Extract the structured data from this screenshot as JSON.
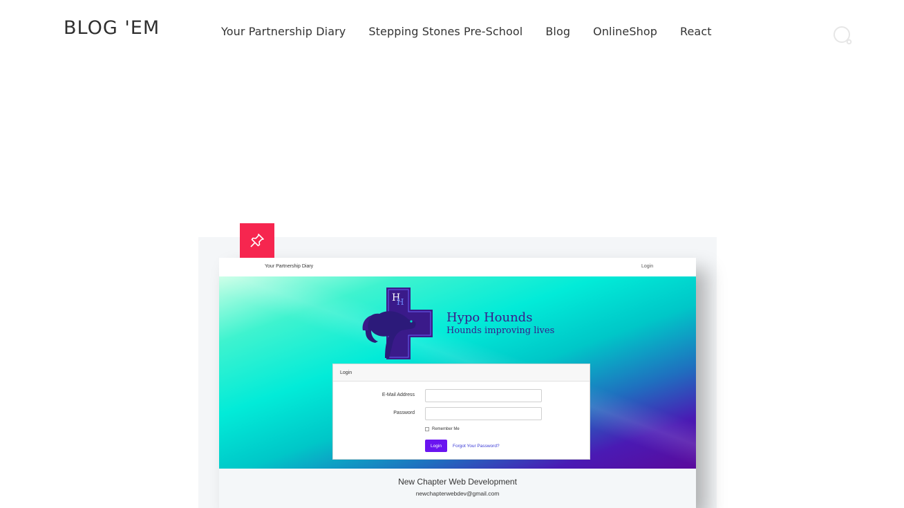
{
  "site": {
    "logo": "BLOG 'EM",
    "nav": [
      {
        "label": "Your Partnership Diary"
      },
      {
        "label": "Stepping Stones Pre-School"
      },
      {
        "label": "Blog"
      },
      {
        "label": "OnlineShop"
      },
      {
        "label": "React"
      }
    ],
    "search_icon": "search-icon"
  },
  "featured": {
    "badge_icon": "pin-icon",
    "badge_color": "#f6264f",
    "screenshot": {
      "nav_brand": "Your Partnership Diary",
      "nav_login": "Login",
      "brand_title": "Hypo Hounds",
      "brand_tagline": "Hounds improving lives",
      "logo_initials": "H",
      "login_card": {
        "heading": "Login",
        "email_label": "E-Mail Address",
        "email_value": "",
        "password_label": "Password",
        "password_value": "",
        "remember_label": "Remember Me",
        "login_button": "Login",
        "forgot_link": "Forgot Your Password?"
      },
      "footer_title": "New Chapter Web Development",
      "footer_email": "newchapterwebdev@gmail.com",
      "accent_color": "#6a14f0",
      "brand_color": "#3a1a8a"
    }
  }
}
